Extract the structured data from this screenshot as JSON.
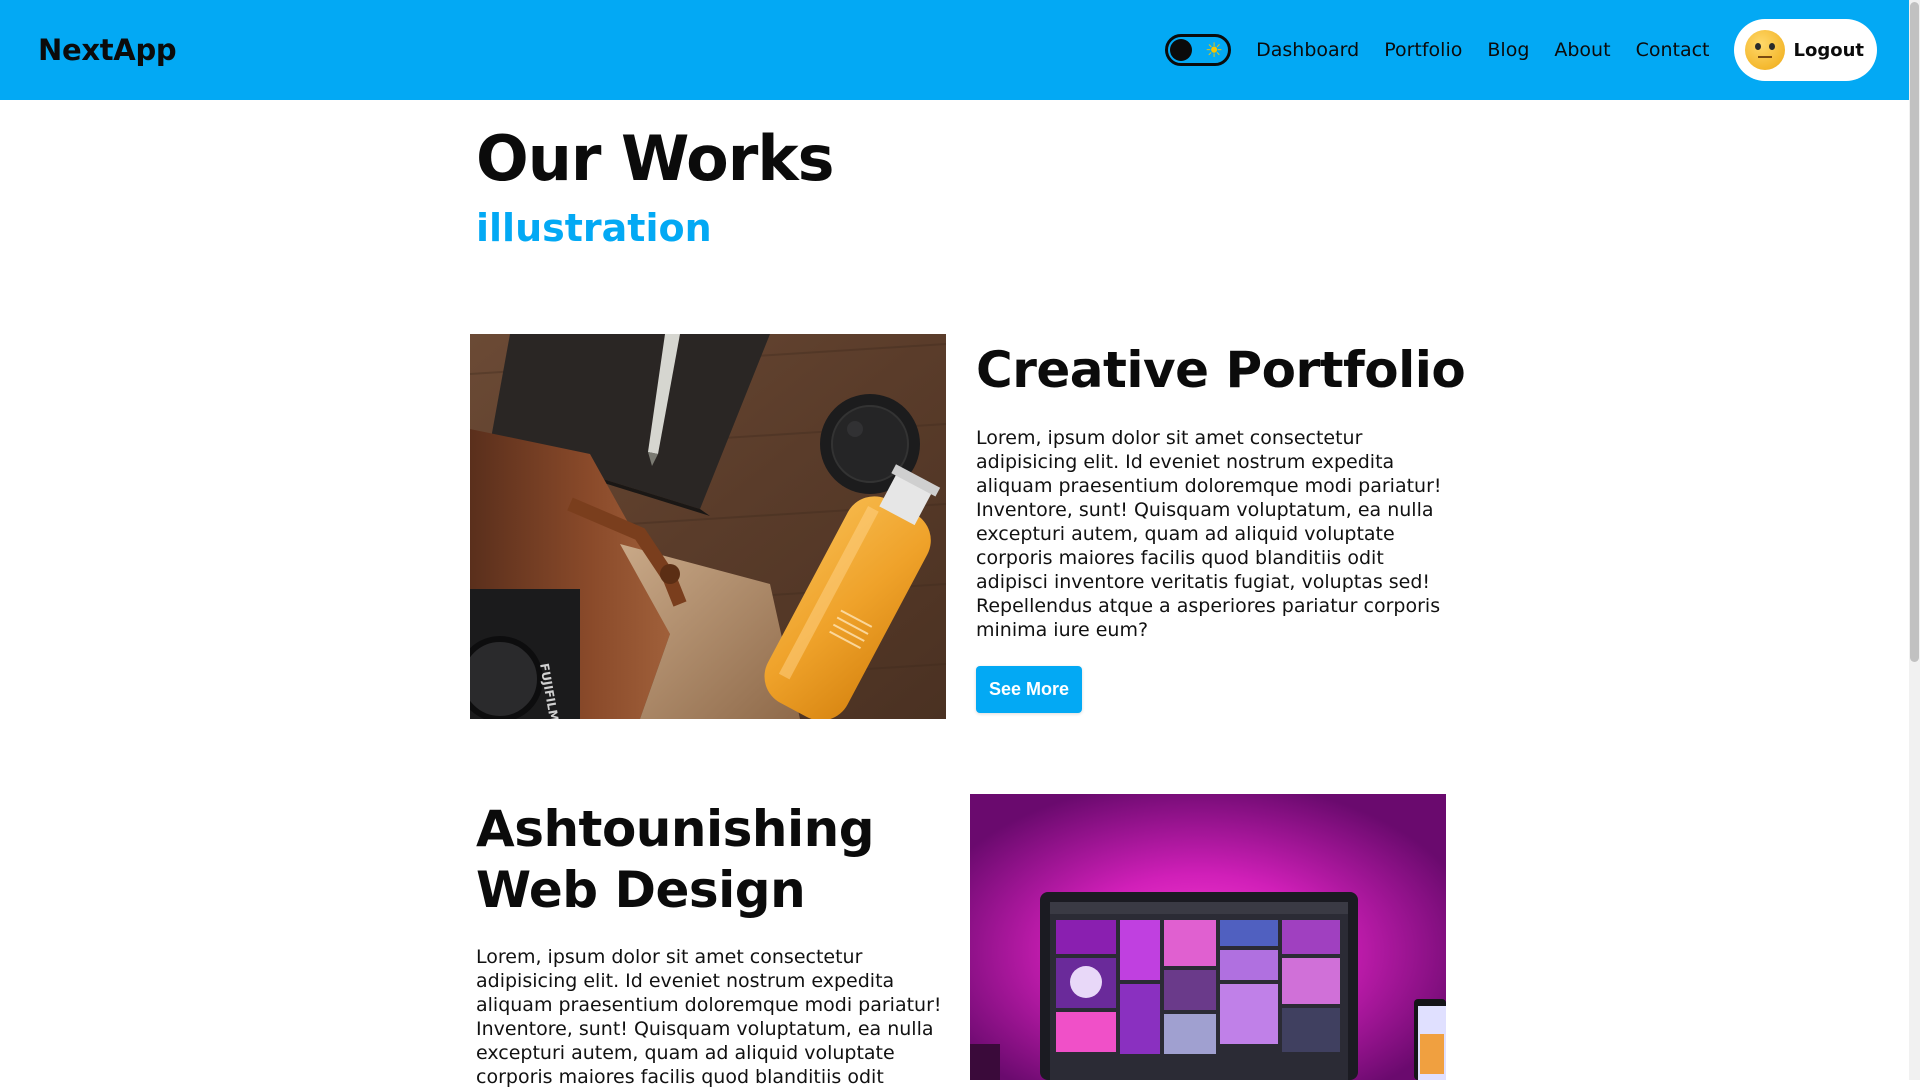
{
  "navbar": {
    "brand": "NextApp",
    "links": [
      "Dashboard",
      "Portfolio",
      "Blog",
      "About",
      "Contact"
    ],
    "theme_toggle_icon": "sun-icon",
    "logout_label": "Logout",
    "colors": {
      "accent": "#03a9f4",
      "text": "#0b0b0b"
    }
  },
  "page": {
    "title": "Our Works",
    "category": "illustration"
  },
  "works": [
    {
      "title": "Creative Portfolio",
      "description": "Lorem, ipsum dolor sit amet consectetur adipisicing elit. Id eveniet nostrum expedita aliquam praesentium doloremque modi pariatur! Inventore, sunt! Quisquam voluptatum, ea nulla excepturi autem, quam ad aliquid voluptate corporis maiores facilis quod blanditiis odit adipisci inventore veritatis fugiat, voluptas sed! Repellendus atque a asperiores pariatur corporis minima iure eum?",
      "button_label": "See More",
      "image_brand_text": "FUJIFILM"
    },
    {
      "title": "Ashtounishing Web Design",
      "description": "Lorem, ipsum dolor sit amet consectetur adipisicing elit. Id eveniet nostrum expedita aliquam praesentium doloremque modi pariatur! Inventore, sunt! Quisquam voluptatum, ea nulla excepturi autem, quam ad aliquid voluptate corporis maiores facilis quod blanditiis odit"
    }
  ]
}
